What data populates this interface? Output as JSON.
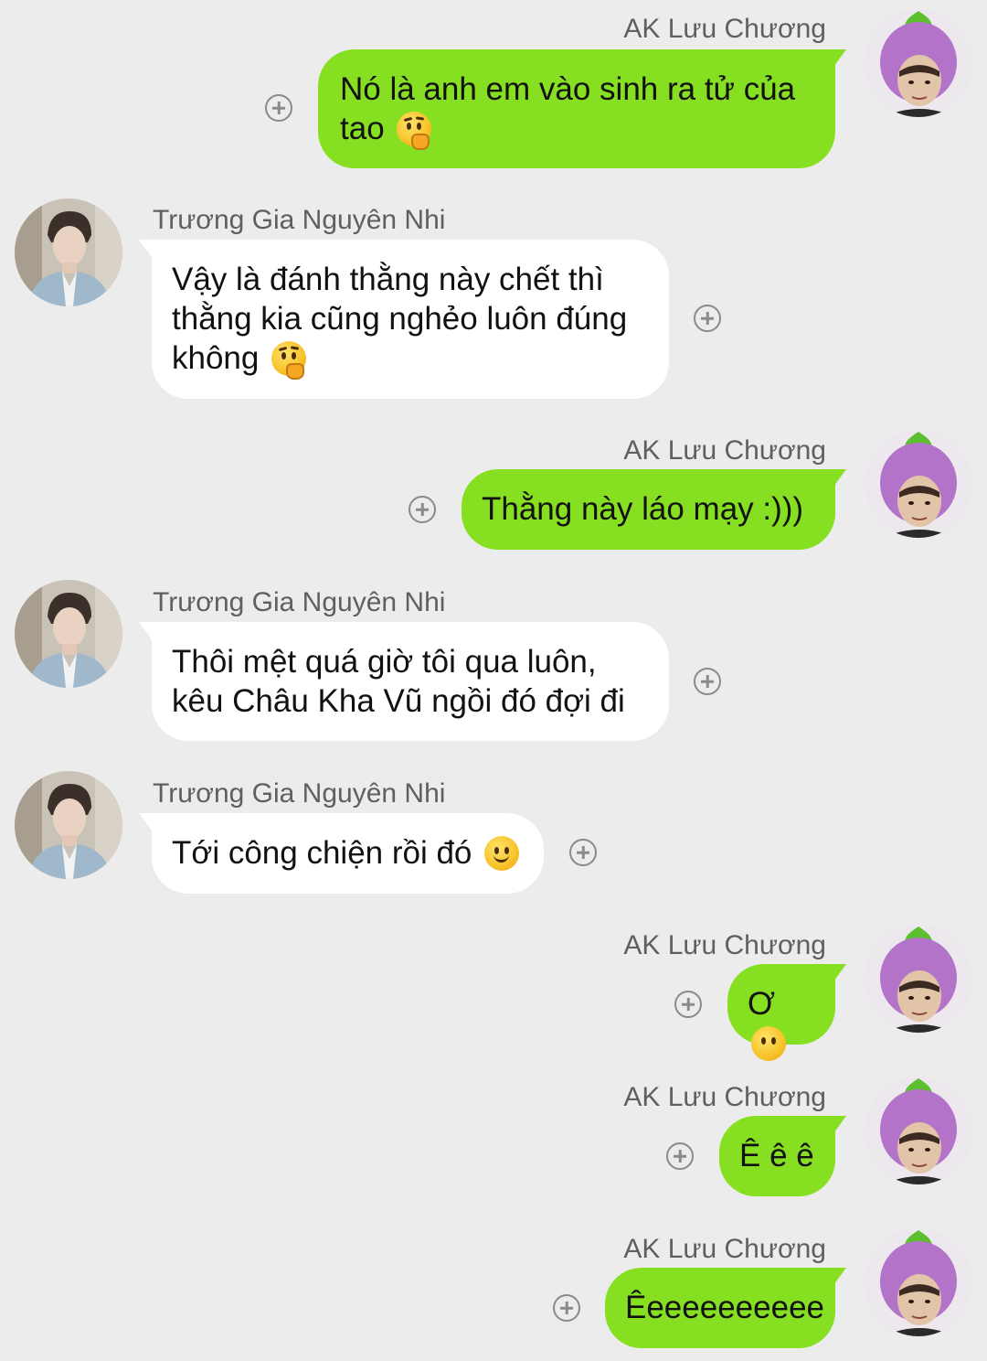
{
  "messages": [
    {
      "direction": "out",
      "sender": "AK Lưu Chương",
      "lines": [
        "Nó là anh em vào sinh ra tử của",
        "tao"
      ],
      "emoji": "thinking-face",
      "avatar": "eggplant-hat-avatar"
    },
    {
      "direction": "in",
      "sender": "Trương Gia Nguyên Nhi",
      "lines": [
        "Vậy là đánh thằng này chết thì",
        "thằng kia cũng nghẻo luôn đúng",
        "không"
      ],
      "emoji": "thinking-face",
      "avatar": "young-man-avatar"
    },
    {
      "direction": "out",
      "sender": "AK Lưu Chương",
      "lines": [
        "Thằng này láo mạy :)))"
      ],
      "emoji": "",
      "avatar": "eggplant-hat-avatar"
    },
    {
      "direction": "in",
      "sender": "Trương Gia Nguyên Nhi",
      "lines": [
        "Thôi mệt quá giờ tôi qua luôn,",
        "kêu Châu Kha Vũ ngồi đó đợi đi"
      ],
      "emoji": "",
      "avatar": "young-man-avatar"
    },
    {
      "direction": "in",
      "sender": "Trương Gia Nguyên Nhi",
      "lines": [
        "Tới công chiện rồi đó"
      ],
      "emoji": "slightly-smiling-face",
      "avatar": "young-man-avatar"
    },
    {
      "direction": "out",
      "sender": "AK Lưu Chương",
      "lines": [
        "Ơ"
      ],
      "emoji": "neutral-face",
      "avatar": "eggplant-hat-avatar"
    },
    {
      "direction": "out",
      "sender": "AK Lưu Chương",
      "lines": [
        "Ê ê ê"
      ],
      "emoji": "",
      "avatar": "eggplant-hat-avatar"
    },
    {
      "direction": "out",
      "sender": "AK Lưu Chương",
      "lines": [
        "Êeeeeeeeeee"
      ],
      "emoji": "",
      "avatar": "eggplant-hat-avatar"
    }
  ],
  "colors": {
    "background": "#ececec",
    "outgoing_bubble": "#86e021",
    "incoming_bubble": "#ffffff",
    "sender_name": "#5f5f5f"
  }
}
